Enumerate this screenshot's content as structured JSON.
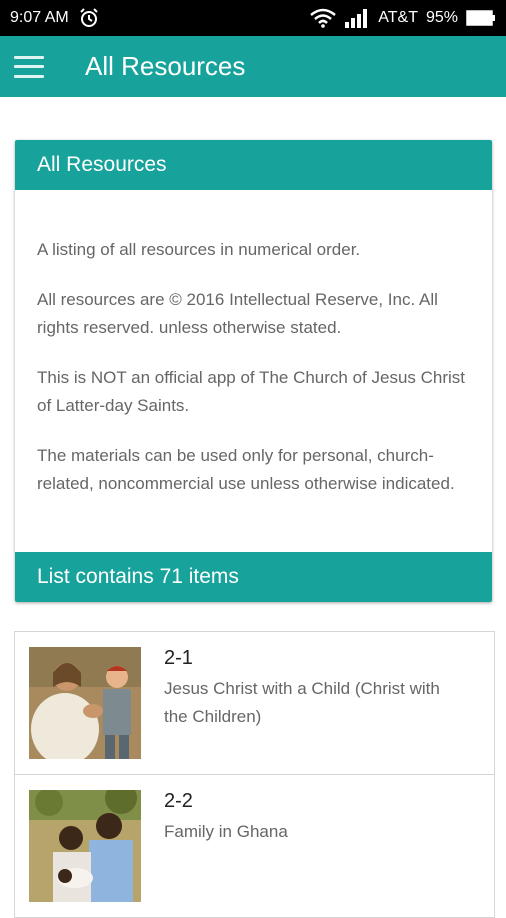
{
  "status": {
    "time": "9:07 AM",
    "carrier": "AT&T",
    "battery": "95%"
  },
  "appbar": {
    "title": "All Resources"
  },
  "card": {
    "header": "All Resources",
    "paragraphs": [
      "A listing of all resources in numerical order.",
      "All resources are © 2016 Intellectual Reserve, Inc. All rights reserved. unless otherwise stated.",
      "This is NOT an official app of The Church of Jesus Christ of Latter-day Saints.",
      "The materials can be used only for personal, church-related, noncommercial use unless otherwise indicated."
    ],
    "footer": "List contains 71 items"
  },
  "items": [
    {
      "number": "2-1",
      "title": "Jesus Christ with a Child (Christ with the Children)"
    },
    {
      "number": "2-2",
      "title": "Family in Ghana"
    }
  ],
  "colors": {
    "accent": "#17a39b",
    "status_bar": "#000000",
    "body_text": "#666666"
  }
}
